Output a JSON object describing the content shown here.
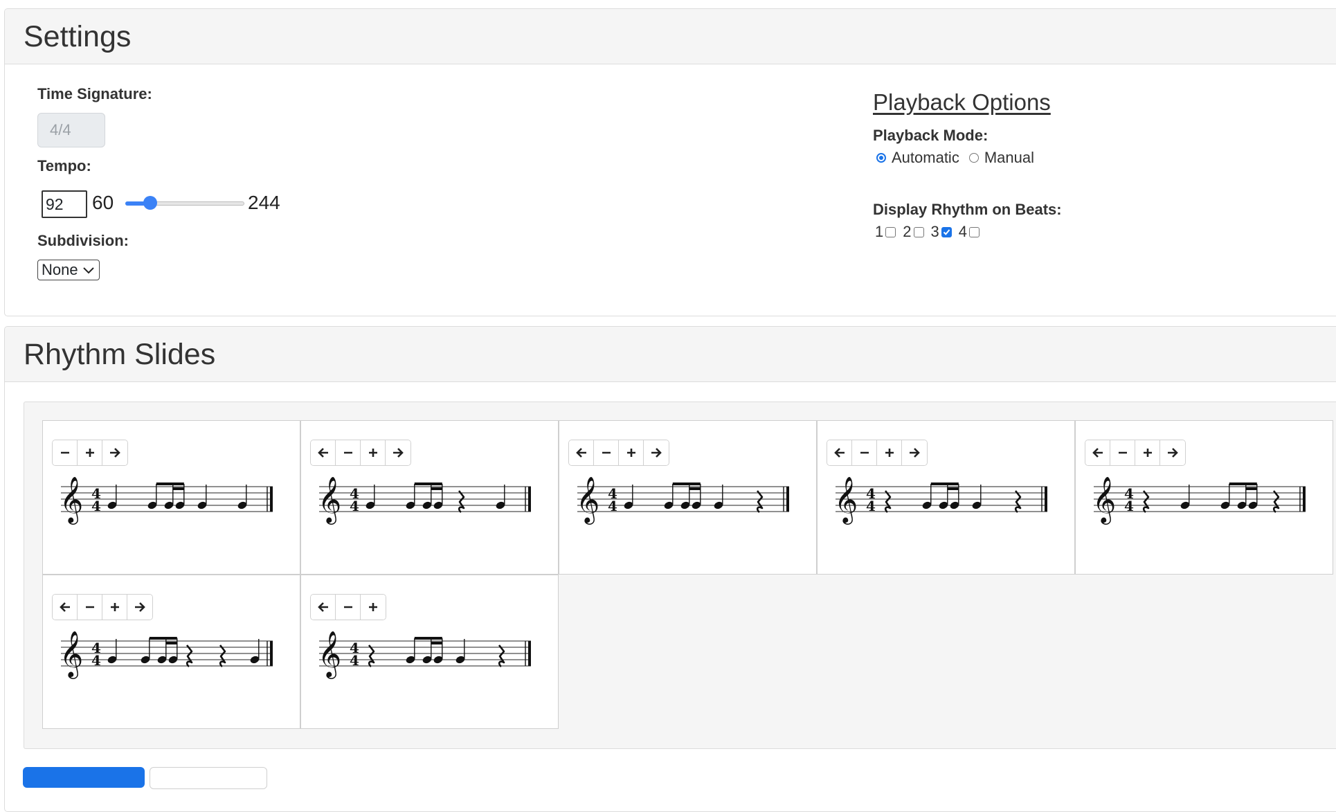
{
  "settings": {
    "title": "Settings",
    "time_signature_label": "Time Signature:",
    "time_signature_value": "4/4",
    "tempo_label": "Tempo:",
    "tempo_value": "92",
    "tempo_min": "60",
    "tempo_max": "244",
    "subdivision_label": "Subdivision:",
    "subdivision_value": "None"
  },
  "playback": {
    "title": "Playback Options",
    "mode_label": "Playback Mode:",
    "mode_automatic": "Automatic",
    "mode_manual": "Manual",
    "mode_selected": "Automatic",
    "display_label": "Display Rhythm on Beats:",
    "beats": [
      {
        "label": "1",
        "checked": false
      },
      {
        "label": "2",
        "checked": false
      },
      {
        "label": "3",
        "checked": true
      },
      {
        "label": "4",
        "checked": false
      }
    ]
  },
  "rhythm": {
    "title": "Rhythm Slides",
    "slides": [
      {
        "buttons": [
          "minus",
          "plus",
          "right"
        ],
        "beats": [
          "q",
          "e16",
          "q",
          "q"
        ]
      },
      {
        "buttons": [
          "left",
          "minus",
          "plus",
          "right"
        ],
        "beats": [
          "q",
          "e16",
          "r",
          "q"
        ]
      },
      {
        "buttons": [
          "left",
          "minus",
          "plus",
          "right"
        ],
        "beats": [
          "q",
          "e16",
          "q",
          "r"
        ]
      },
      {
        "buttons": [
          "left",
          "minus",
          "plus",
          "right"
        ],
        "beats": [
          "r",
          "e16",
          "q",
          "r"
        ]
      },
      {
        "buttons": [
          "left",
          "minus",
          "plus",
          "right"
        ],
        "beats": [
          "r",
          "q",
          "e16",
          "r"
        ]
      },
      {
        "buttons": [
          "left",
          "minus",
          "plus",
          "right"
        ],
        "beats": [
          "q",
          "e16",
          "r",
          "r",
          "q"
        ]
      },
      {
        "buttons": [
          "left",
          "minus",
          "plus"
        ],
        "beats": [
          "r",
          "e16",
          "q",
          "r"
        ]
      }
    ]
  },
  "colors": {
    "accent": "#1a73e8",
    "header_bg": "#f5f5f5",
    "border": "#dcdcdc"
  }
}
